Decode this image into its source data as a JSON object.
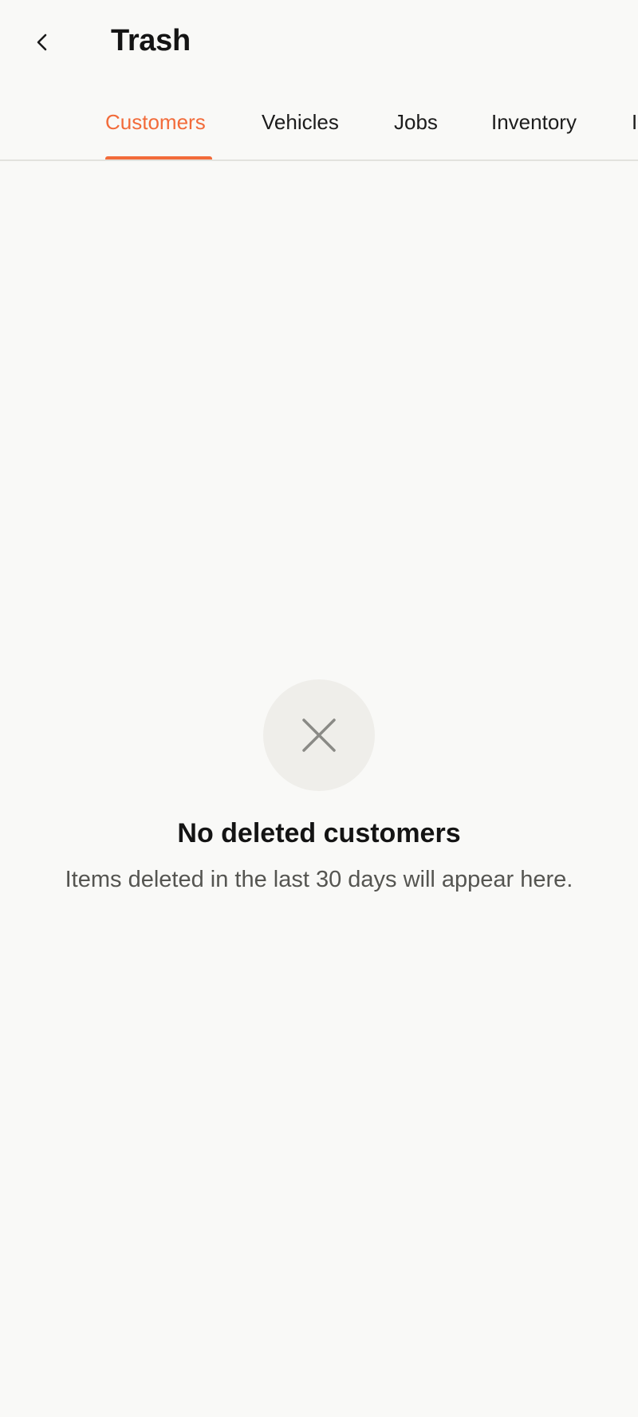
{
  "header": {
    "title": "Trash",
    "back_icon": "chevron-left-icon"
  },
  "tabs": [
    {
      "label": "Customers",
      "active": true
    },
    {
      "label": "Vehicles",
      "active": false
    },
    {
      "label": "Jobs",
      "active": false
    },
    {
      "label": "Inventory",
      "active": false
    },
    {
      "label": "I",
      "active": false
    }
  ],
  "empty_state": {
    "icon": "close-icon",
    "title": "No deleted customers",
    "subtitle": "Items deleted in the last 30 days will appear here."
  },
  "colors": {
    "accent": "#f26b3a",
    "background": "#f9f9f7",
    "icon_circle": "#efeeea",
    "icon": "#8a8a86"
  }
}
